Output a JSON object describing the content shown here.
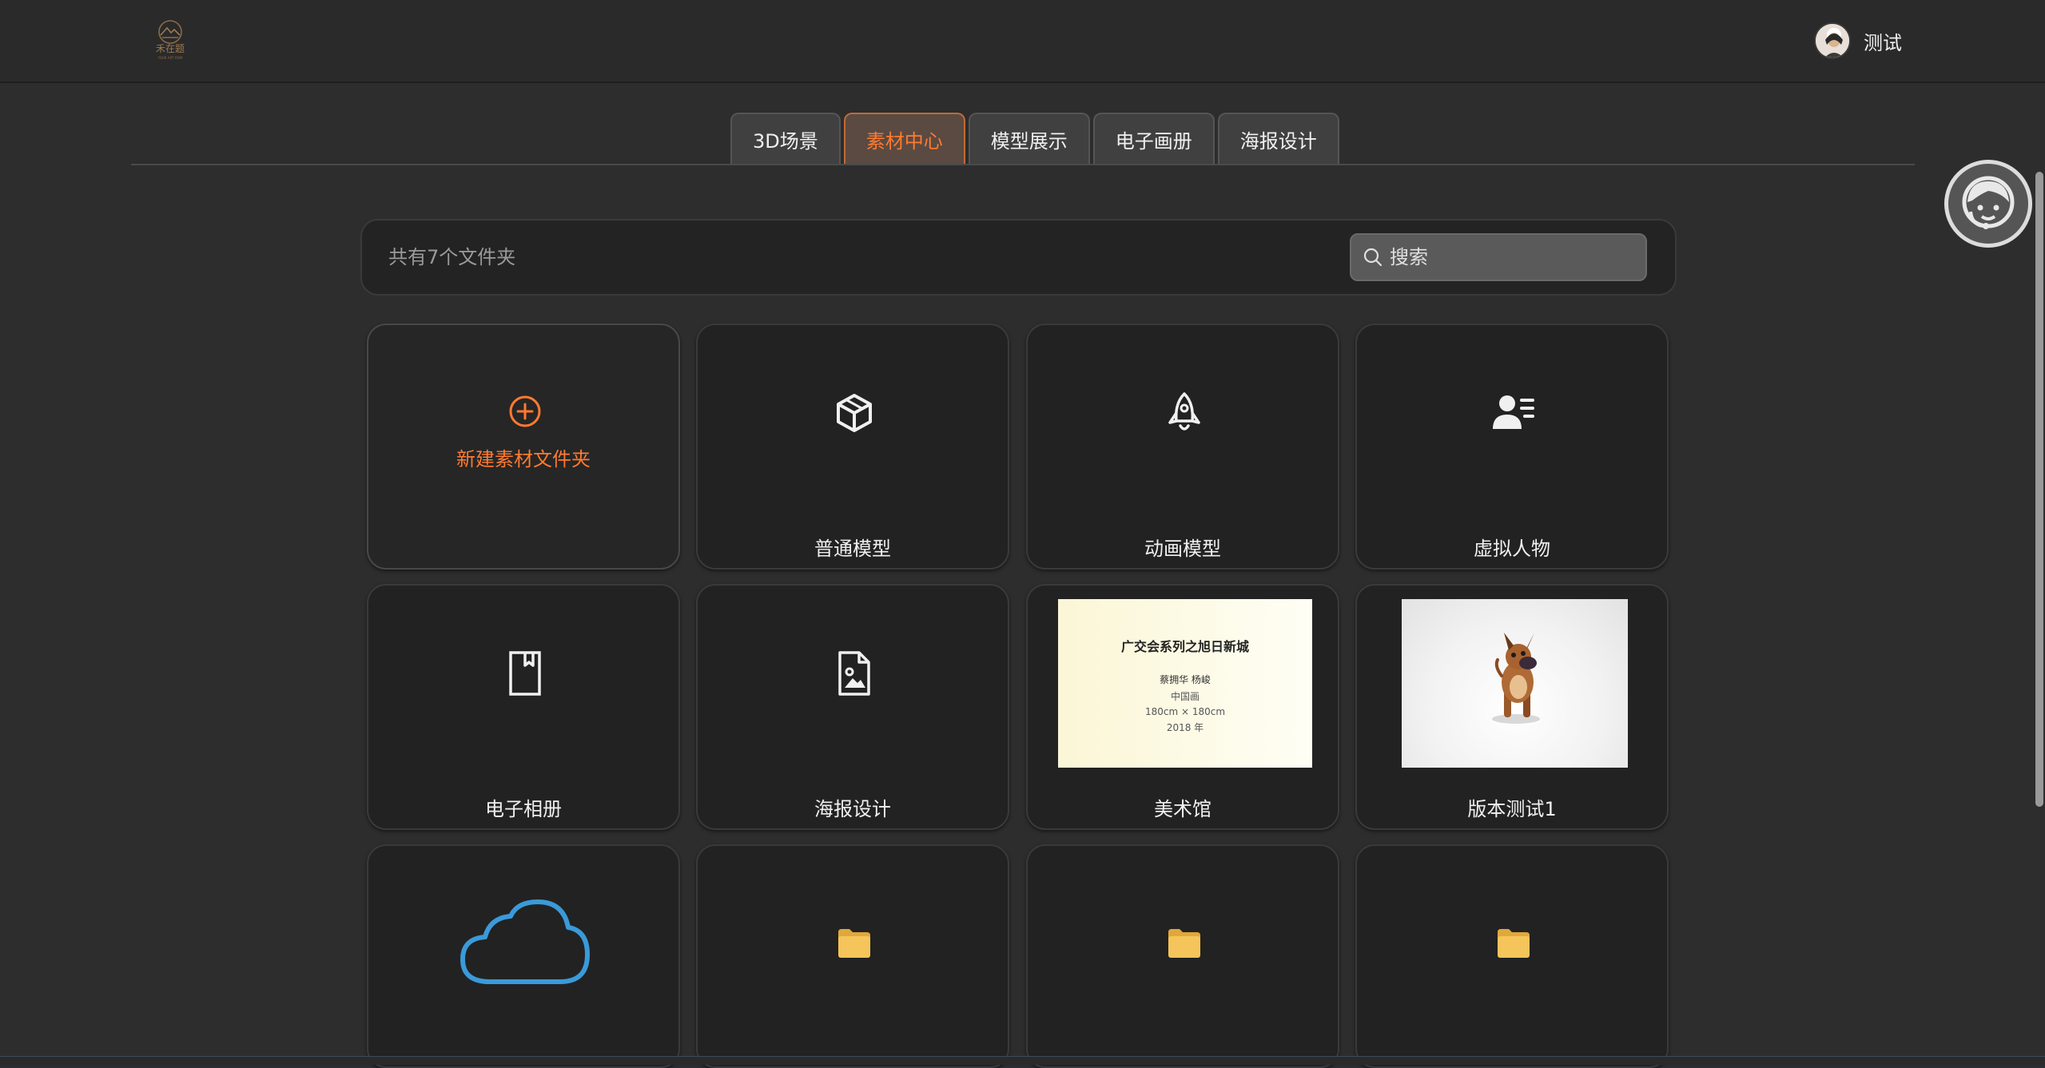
{
  "header": {
    "user_name": "测试"
  },
  "tabs": [
    "3D场景",
    "素材中心",
    "模型展示",
    "电子画册",
    "海报设计"
  ],
  "active_tab": "素材中心",
  "colors": {
    "accent": "#ff7a30",
    "cloud": "#3a9ad9",
    "folder": "#f5c45a"
  },
  "toolbar": {
    "count_text": "共有7个文件夹",
    "search_placeholder": "搜索"
  },
  "new_folder": {
    "label": "新建素材文件夹",
    "icon": "plus-circle-icon"
  },
  "folders": [
    {
      "label": "普通模型",
      "icon": "cube-icon"
    },
    {
      "label": "动画模型",
      "icon": "rocket-icon"
    },
    {
      "label": "虚拟人物",
      "icon": "user-list-icon"
    },
    {
      "label": "电子相册",
      "icon": "bookmark-icon"
    },
    {
      "label": "海报设计",
      "icon": "image-file-icon"
    },
    {
      "label": "美术馆",
      "icon": "poster-thumbnail"
    },
    {
      "label": "版本测试1",
      "icon": "dog-model-thumbnail"
    },
    {
      "label": "",
      "icon": "cloud-icon"
    },
    {
      "label": "",
      "icon": "folder-icon"
    },
    {
      "label": "",
      "icon": "folder-icon"
    },
    {
      "label": "",
      "icon": "folder-icon"
    }
  ],
  "poster": {
    "title": "广交会系列之旭日新城",
    "authors": "蔡拥华  杨峻",
    "line1": "中国画",
    "line2": "180cm × 180cm",
    "line3": "2018 年"
  }
}
